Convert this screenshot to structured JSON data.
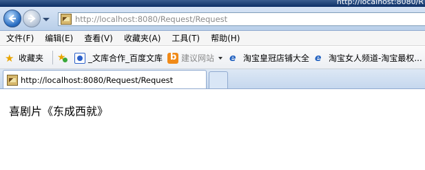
{
  "window": {
    "title": "http://localhost:8080/R"
  },
  "navigation": {
    "back_icon": "back-arrow-icon",
    "forward_icon": "forward-arrow-icon",
    "address": {
      "host": "http://localhost",
      "rest": ":8080/Request/Request"
    }
  },
  "menu": [
    {
      "label": "文件(F)"
    },
    {
      "label": "编辑(E)"
    },
    {
      "label": "查看(V)"
    },
    {
      "label": "收藏夹(A)"
    },
    {
      "label": "工具(T)"
    },
    {
      "label": "帮助(H)"
    }
  ],
  "favorites": {
    "label": "收藏夹",
    "items": [
      {
        "label": "_文库合作_百度文库",
        "icon": "baidu-paw-icon"
      },
      {
        "label": "建议网站",
        "icon": "suggested-sites-icon"
      },
      {
        "label": "淘宝皇冠店铺大全",
        "icon": "ie-page-icon"
      },
      {
        "label": "淘宝女人频道-淘宝最权...",
        "icon": "ie-page-icon"
      }
    ]
  },
  "tabs": [
    {
      "label": "http://localhost:8080/Request/Request",
      "active": true
    }
  ],
  "page": {
    "text": "喜剧片《东成西就》"
  },
  "colors": {
    "chrome": "#c5d7ee",
    "link_blue": "#1e5fbf",
    "star": "#e8a400"
  }
}
